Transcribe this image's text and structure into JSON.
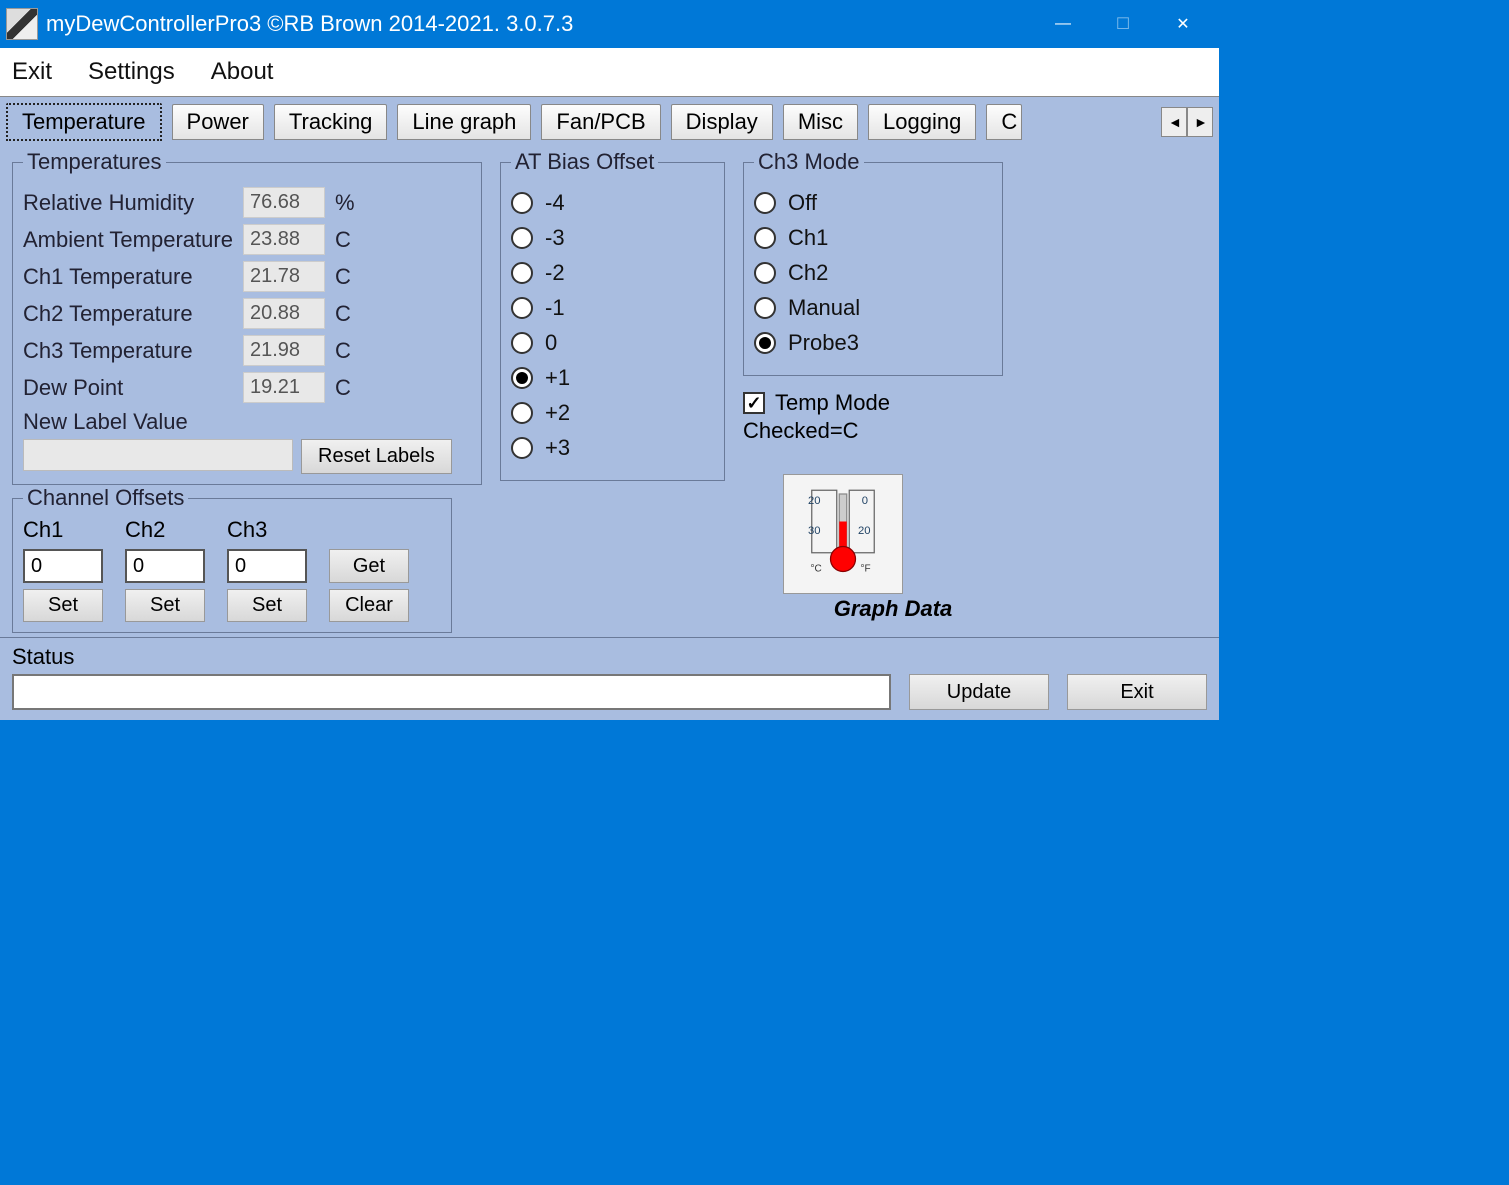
{
  "window": {
    "title": "myDewControllerPro3 ©RB Brown 2014-2021. 3.0.7.3"
  },
  "menu": {
    "exit": "Exit",
    "settings": "Settings",
    "about": "About"
  },
  "tabs": {
    "items": [
      "Temperature",
      "Power",
      "Tracking",
      "Line graph",
      "Fan/PCB",
      "Display",
      "Misc",
      "Logging"
    ],
    "overflow": "C",
    "active": 0
  },
  "temperatures": {
    "legend": "Temperatures",
    "rows": {
      "rh": {
        "label": "Relative Humidity",
        "value": "76.68",
        "unit": "%"
      },
      "at": {
        "label": "Ambient Temperature",
        "value": "23.88",
        "unit": "C"
      },
      "ch1": {
        "label": "Ch1 Temperature",
        "value": "21.78",
        "unit": "C"
      },
      "ch2": {
        "label": "Ch2 Temperature",
        "value": "20.88",
        "unit": "C"
      },
      "ch3": {
        "label": "Ch3 Temperature",
        "value": "21.98",
        "unit": "C"
      },
      "dp": {
        "label": "Dew Point",
        "value": "19.21",
        "unit": "C"
      }
    },
    "newlabel": "New Label Value",
    "reset": "Reset Labels"
  },
  "atbias": {
    "legend": "AT Bias Offset",
    "options": [
      "-4",
      "-3",
      "-2",
      "-1",
      "0",
      "+1",
      "+2",
      "+3"
    ],
    "selected": "+1"
  },
  "ch3mode": {
    "legend": "Ch3 Mode",
    "options": [
      "Off",
      "Ch1",
      "Ch2",
      "Manual",
      "Probe3"
    ],
    "selected": "Probe3"
  },
  "tempmode": {
    "label": "Temp Mode",
    "sub": "Checked=C",
    "checked": true
  },
  "offsets": {
    "legend": "Channel Offsets",
    "ch1": {
      "label": "Ch1",
      "value": "0",
      "set": "Set"
    },
    "ch2": {
      "label": "Ch2",
      "value": "0",
      "set": "Set"
    },
    "ch3": {
      "label": "Ch3",
      "value": "0",
      "set": "Set"
    },
    "get": "Get",
    "clear": "Clear"
  },
  "graph": {
    "label": "Graph Data"
  },
  "status": {
    "label": "Status",
    "update": "Update",
    "exit": "Exit",
    "value": ""
  }
}
